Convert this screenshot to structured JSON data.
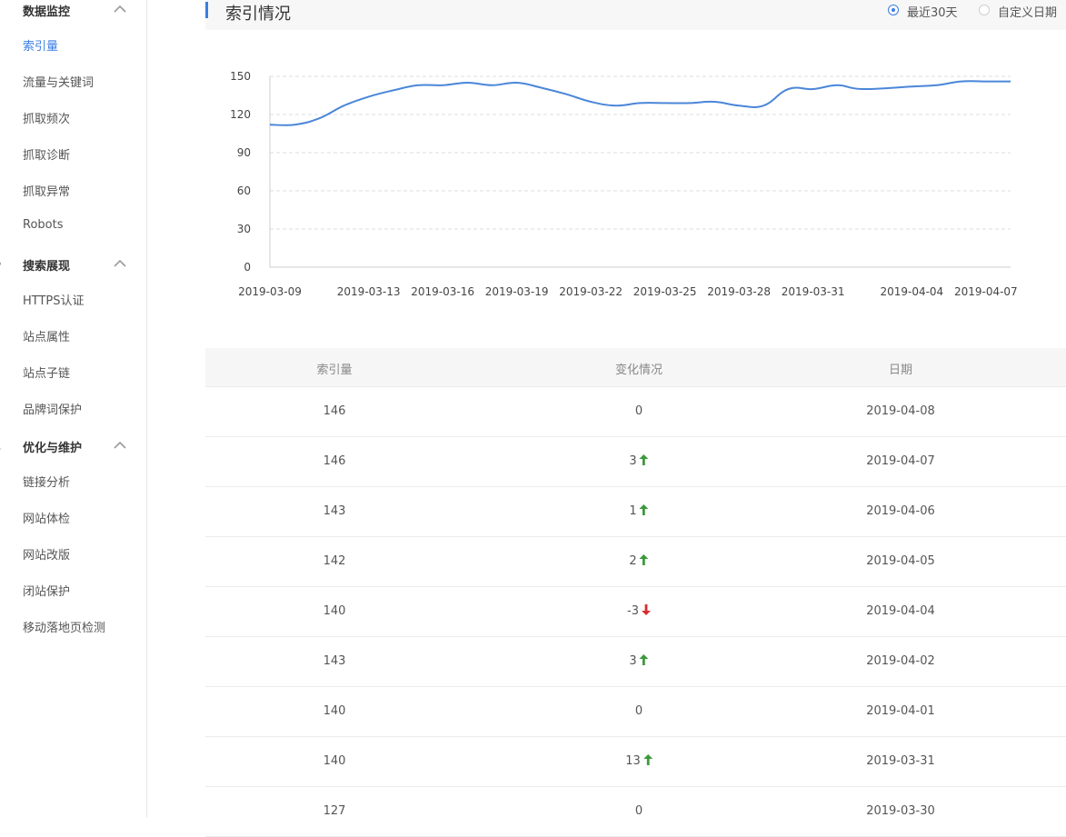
{
  "sidebar": {
    "sections": [
      {
        "title": "数据监控",
        "items": [
          "索引量",
          "流量与关键词",
          "抓取频次",
          "抓取诊断",
          "抓取异常",
          "Robots"
        ]
      },
      {
        "title": "搜索展现",
        "items": [
          "HTTPS认证",
          "站点属性",
          "站点子链",
          "品牌词保护"
        ]
      },
      {
        "title": "优化与维护",
        "items": [
          "链接分析",
          "网站体检",
          "网站改版",
          "闭站保护",
          "移动落地页检测"
        ]
      }
    ],
    "active_item": "索引量"
  },
  "header": {
    "title": "索引情况",
    "range_options": [
      {
        "label": "最近30天",
        "checked": true
      },
      {
        "label": "自定义日期",
        "checked": false
      }
    ]
  },
  "colors": {
    "accent": "#3a7ee2",
    "line": "#4a86d8",
    "up": "#3b9a3b",
    "down": "#d82d2d"
  },
  "chart_data": {
    "type": "line",
    "ylim": [
      0,
      150
    ],
    "yticks": [
      0,
      30,
      60,
      90,
      120,
      150
    ],
    "xlabels": [
      "2019-03-09",
      "2019-03-13",
      "2019-03-16",
      "2019-03-19",
      "2019-03-22",
      "2019-03-25",
      "2019-03-28",
      "2019-03-31",
      "2019-04-04",
      "2019-04-07"
    ],
    "grid": true,
    "legend": false,
    "x": [
      "2019-03-09",
      "2019-03-10",
      "2019-03-11",
      "2019-03-12",
      "2019-03-13",
      "2019-03-14",
      "2019-03-15",
      "2019-03-16",
      "2019-03-17",
      "2019-03-18",
      "2019-03-19",
      "2019-03-20",
      "2019-03-21",
      "2019-03-22",
      "2019-03-23",
      "2019-03-24",
      "2019-03-25",
      "2019-03-26",
      "2019-03-27",
      "2019-03-28",
      "2019-03-29",
      "2019-03-30",
      "2019-03-31",
      "2019-04-01",
      "2019-04-02",
      "2019-04-04",
      "2019-04-05",
      "2019-04-06",
      "2019-04-07",
      "2019-04-08"
    ],
    "values": [
      112,
      112,
      117,
      127,
      134,
      139,
      143,
      143,
      145,
      143,
      145,
      141,
      136,
      130,
      127,
      129,
      129,
      129,
      130,
      127,
      127,
      140,
      140,
      143,
      140,
      142,
      143,
      146,
      146,
      146
    ]
  },
  "table": {
    "headers": [
      "索引量",
      "变化情况",
      "日期"
    ],
    "rows": [
      {
        "index": "146",
        "change": "0",
        "dir": "none",
        "date": "2019-04-08"
      },
      {
        "index": "146",
        "change": "3",
        "dir": "up",
        "date": "2019-04-07"
      },
      {
        "index": "143",
        "change": "1",
        "dir": "up",
        "date": "2019-04-06"
      },
      {
        "index": "142",
        "change": "2",
        "dir": "up",
        "date": "2019-04-05"
      },
      {
        "index": "140",
        "change": "-3",
        "dir": "down",
        "date": "2019-04-04"
      },
      {
        "index": "143",
        "change": "3",
        "dir": "up",
        "date": "2019-04-02"
      },
      {
        "index": "140",
        "change": "0",
        "dir": "none",
        "date": "2019-04-01"
      },
      {
        "index": "140",
        "change": "13",
        "dir": "up",
        "date": "2019-03-31"
      },
      {
        "index": "127",
        "change": "0",
        "dir": "none",
        "date": "2019-03-30"
      }
    ]
  }
}
